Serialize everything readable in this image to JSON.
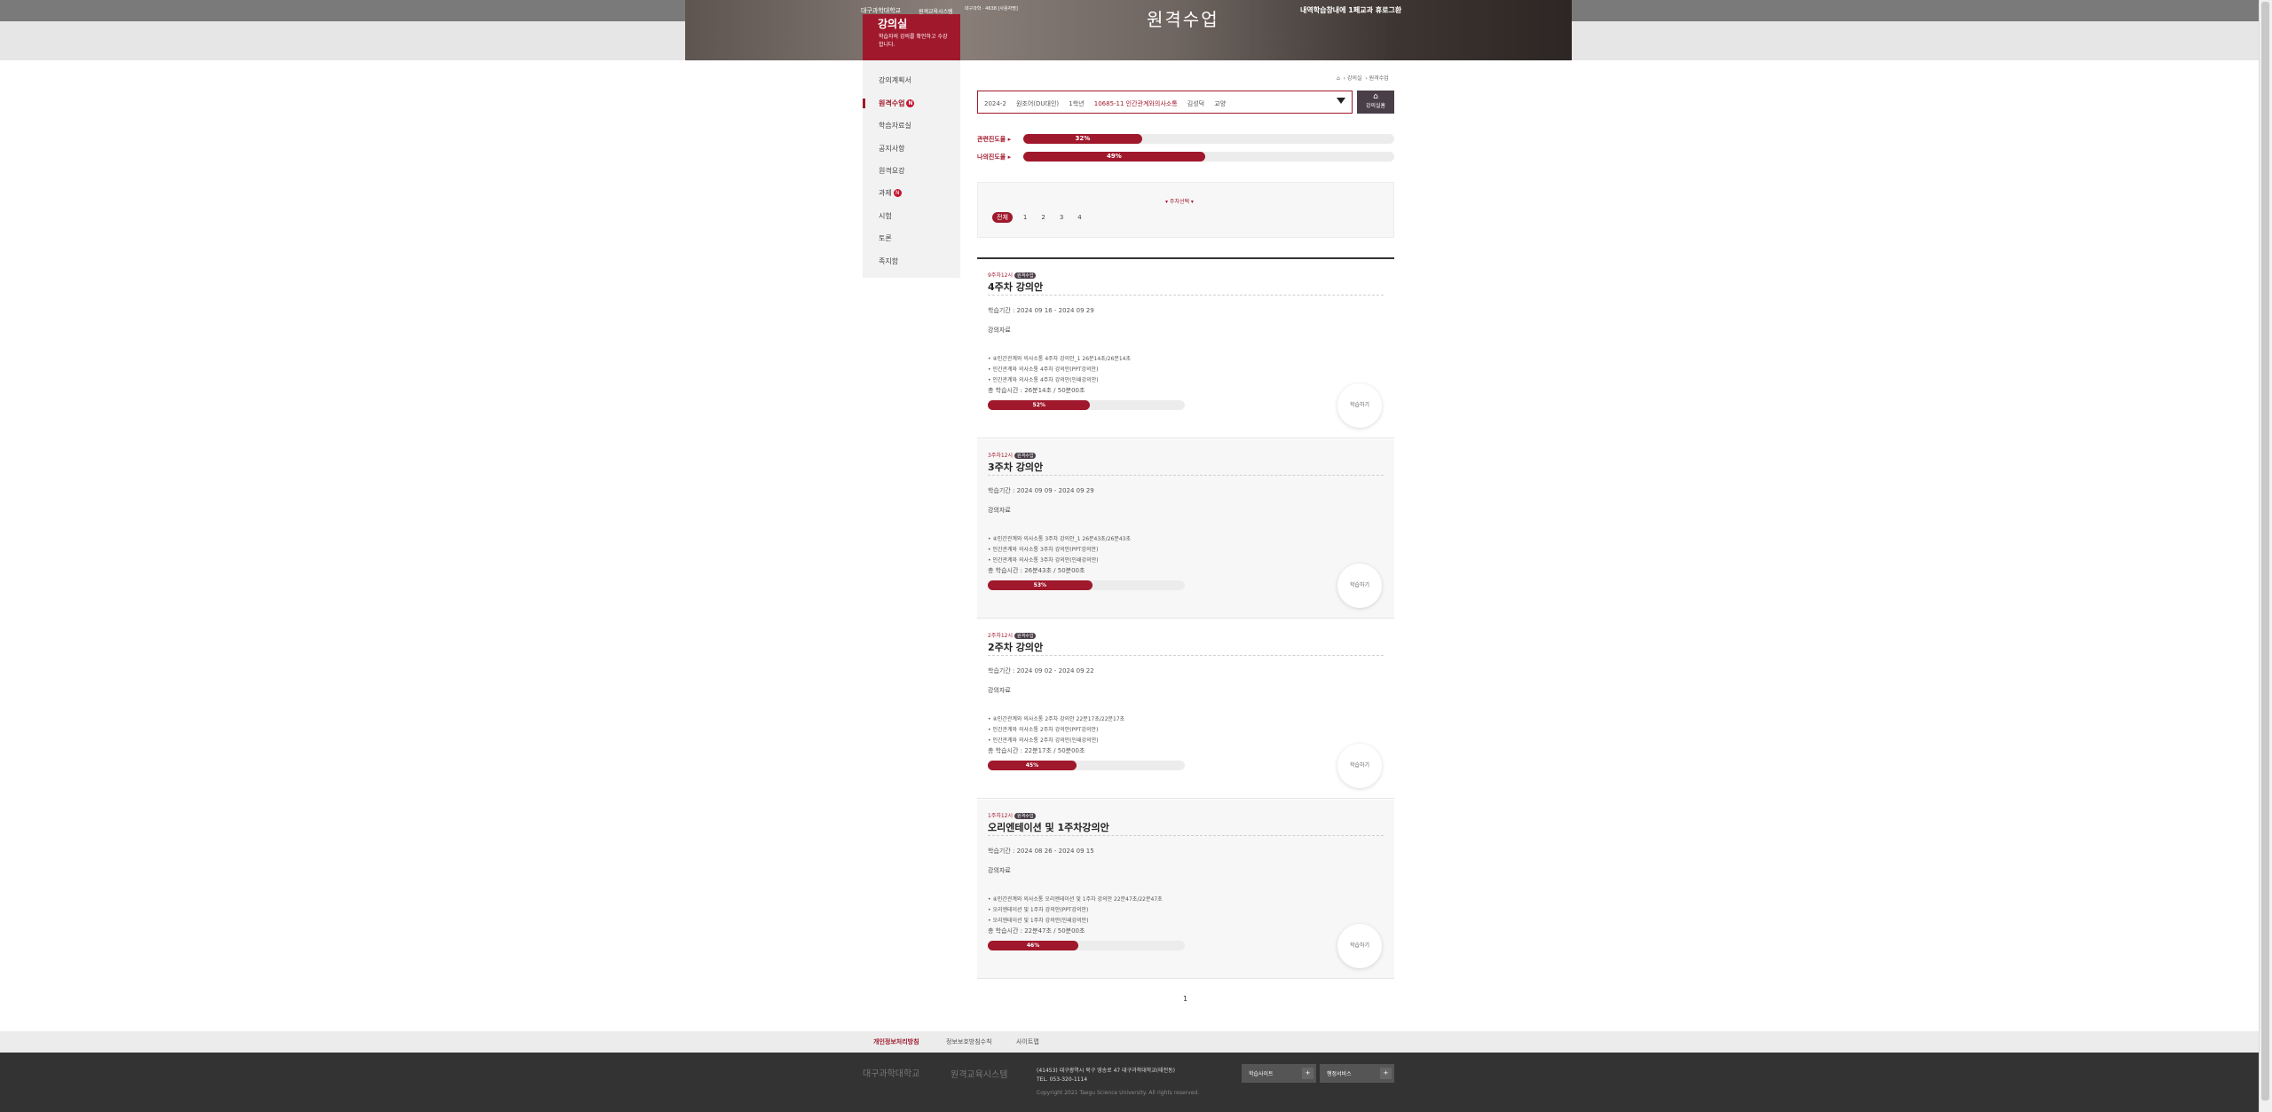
{
  "header": {
    "title": "원격수업",
    "notice": "내역학습창내에 1페교과 휴로그환",
    "logo": "대구과학대학교",
    "system": "원격교육시스템",
    "user_info": "대구과학 · 4638 [사용자명]"
  },
  "lecture_room": {
    "title": "강의실",
    "desc": "학습자의 강의를 확인하고 수강합니다."
  },
  "sidebar": {
    "items": [
      {
        "label": "강의계획서"
      },
      {
        "label": "원격수업",
        "badge": "N"
      },
      {
        "label": "학습자료실"
      },
      {
        "label": "공지사항"
      },
      {
        "label": "원격요강"
      },
      {
        "label": "과제",
        "badge": "N"
      },
      {
        "label": "시험"
      },
      {
        "label": "토론"
      },
      {
        "label": "족지함"
      }
    ]
  },
  "breadcrumb": {
    "items": [
      "강의실",
      "원격수업"
    ]
  },
  "course": {
    "term": "2024-2",
    "dept": "원조어(DU대인)",
    "year": "1학년",
    "course": "10685-11 인간관계와의사소통",
    "professor": "김성덕",
    "type": "교양"
  },
  "lecroom_home": "강의실홈",
  "progress": {
    "attendance": {
      "label": "관련진도율",
      "value": 32,
      "text": "32%"
    },
    "my": {
      "label": "나의진도율",
      "value": 49,
      "text": "49%"
    }
  },
  "week_select": {
    "label": "주차선택",
    "chips": [
      "전체",
      "1",
      "2",
      "3",
      "4"
    ]
  },
  "weeks": [
    {
      "date": "9주차12시",
      "tag": "원격수업",
      "title": "4주차 강의안",
      "period": "학습기간 : 2024 09 16 - 2024 09 29",
      "materials_label": "강의자료",
      "materials": [
        "④인간관계와 의사소통 4주차 강의안_1    26분14초/26분14초",
        "인간관계와 의사소통 4주차 강의안(PPT강의안)",
        "인간관계와 의사소통 4주차 강의안(인쇄강의안)"
      ],
      "total": "총 학습시간 : 26분14초 / 50분00초",
      "progress": 52,
      "progress_text": "52%",
      "button": "학습하기"
    },
    {
      "date": "3주차12시",
      "tag": "원격수업",
      "title": "3주차 강의안",
      "period": "학습기간 : 2024 09 09 - 2024 09 29",
      "materials_label": "강의자료",
      "materials": [
        "④인간관계와 의사소통 3주차 강의안_1    26분43초/26분43초",
        "인간관계와 의사소통 3주차 강의안(PPT강의안)",
        "인간관계와 의사소통 3주차 강의안(인쇄강의안)"
      ],
      "total": "총 학습시간 : 26분43초 / 50분00초",
      "progress": 53,
      "progress_text": "53%",
      "button": "학습하기"
    },
    {
      "date": "2주차12시",
      "tag": "원격수업",
      "title": "2주차 강의안",
      "period": "학습기간 : 2024 09 02 - 2024 09 22",
      "materials_label": "강의자료",
      "materials": [
        "④인간관계와 의사소통 2주차 강의안    22분17초/22분17초",
        "인간관계와 의사소통 2주차 강의안(PPT강의안)",
        "인간관계와 의사소통 2주차 강의안(인쇄강의안)"
      ],
      "total": "총 학습시간 : 22분17초 / 50분00초",
      "progress": 45,
      "progress_text": "45%",
      "button": "학습하기"
    },
    {
      "date": "1주차12시",
      "tag": "원격수업",
      "title": "오리엔테이션 및 1주차강의안",
      "period": "학습기간 : 2024 08 26 - 2024 09 15",
      "materials_label": "강의자료",
      "materials": [
        "④인간관계와 의사소통 오리엔테이션 및 1주차 강의안    22분47초/22분47초",
        "오리엔테이션 및 1주차 강의안(PPT강의안)",
        "오리엔테이션 및 1주차 강의안(인쇄강의안)"
      ],
      "total": "총 학습시간 : 22분47초 / 50분00초",
      "progress": 46,
      "progress_text": "46%",
      "button": "학습하기"
    }
  ],
  "pager": "1",
  "footer": {
    "links": [
      "개인정보처리방침",
      "정보보호방침수칙",
      "사이트맵"
    ],
    "logo1": "대구과학대학교",
    "logo2": "원격교육시스템",
    "address": "(41453) 대구광역시 북구 영송로 47 대구과학대학교(태전동)",
    "tel": "TEL. 053-320-1114",
    "copyright": "Copyright 2021 Taegu Science University. All rights reserved.",
    "select1": "학습사이트",
    "select2": "행정서비스"
  },
  "colors": {
    "accent": "#a0182c",
    "dark": "#4a3f48"
  }
}
